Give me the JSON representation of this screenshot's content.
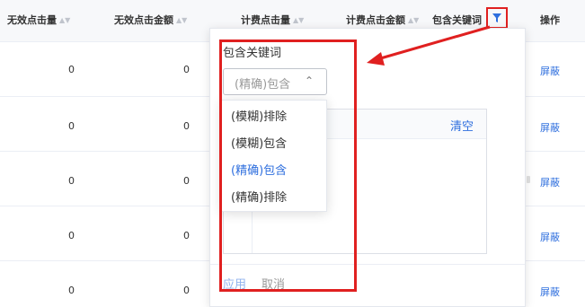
{
  "table": {
    "headers": {
      "invalid_clicks": "无效点击量",
      "invalid_click_amount": "无效点击金额",
      "billed_clicks": "计费点击量",
      "billed_click_amount": "计费点击金额",
      "contains_keyword": "包含关键词",
      "actions": "操作"
    },
    "rows": [
      {
        "invalid_clicks": "0",
        "invalid_click_amount": "0",
        "action": "屏蔽"
      },
      {
        "invalid_clicks": "0",
        "invalid_click_amount": "0",
        "action": "屏蔽"
      },
      {
        "invalid_clicks": "0",
        "invalid_click_amount": "0",
        "action": "屏蔽"
      },
      {
        "invalid_clicks": "0",
        "invalid_click_amount": "0",
        "action": "屏蔽"
      },
      {
        "invalid_clicks": "0",
        "invalid_click_amount": "0",
        "action": "屏蔽"
      }
    ]
  },
  "filter_panel": {
    "title": "包含关键词",
    "select_value": "(精确)包含",
    "clear_label": "清空",
    "apply_label": "应用",
    "cancel_label": "取消"
  },
  "dropdown": {
    "options": [
      {
        "label": "(模糊)排除",
        "selected": false
      },
      {
        "label": "(模糊)包含",
        "selected": false
      },
      {
        "label": "(精确)包含",
        "selected": true
      },
      {
        "label": "(精确)排除",
        "selected": false
      }
    ]
  },
  "icons": {
    "sort": "sort-caret-icon",
    "filter": "filter-funnel-icon",
    "chevron": "chevron-up-icon"
  },
  "colors": {
    "accent": "#2f6fde",
    "annotation": "#e02020"
  }
}
